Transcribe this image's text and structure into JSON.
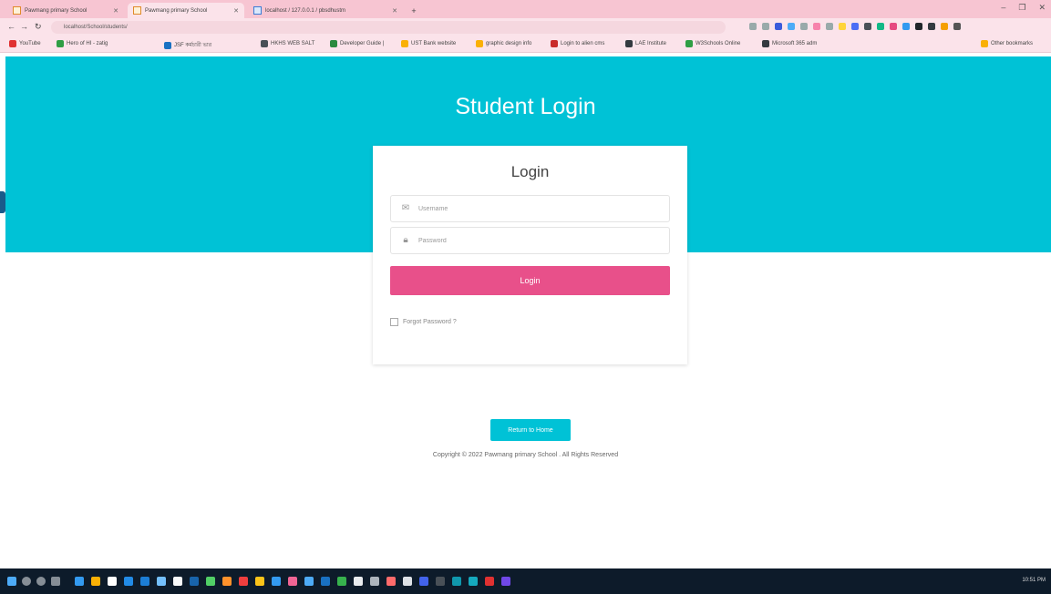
{
  "browser": {
    "tabs": [
      {
        "label": "Pawmang primary School"
      },
      {
        "label": "Pawmang primary School"
      },
      {
        "label": "localhost / 127.0.0.1 / pbsdhustm"
      }
    ],
    "url": "localhost/School/students/",
    "bookmarks": [
      "YouTube",
      "Hero of HI - zatig",
      "JSF কর্মচারী ভার",
      "HKHS WEB SALT",
      "Developer Guide |",
      "UST Bank website",
      "graphic design info",
      "Login to alien cms",
      "LAE Institute",
      "W3Schools Online",
      "Microsoft 365 adm",
      "Other bookmarks"
    ]
  },
  "page": {
    "hero_title": "Student Login",
    "card_title": "Login",
    "username_placeholder": "Username",
    "password_placeholder": "Password",
    "login_button": "Login",
    "forgot_label": "Forgot Password ?",
    "home_button": "Return to Home",
    "copyright": "Copyright © 2022 Pawmang primary School . All Rights Reserved"
  },
  "colors": {
    "hero": "#00c2d6",
    "login_button": "#e8508a",
    "tabbar": "#f7c5d2"
  },
  "taskbar": {
    "clock": "10:51 PM"
  }
}
